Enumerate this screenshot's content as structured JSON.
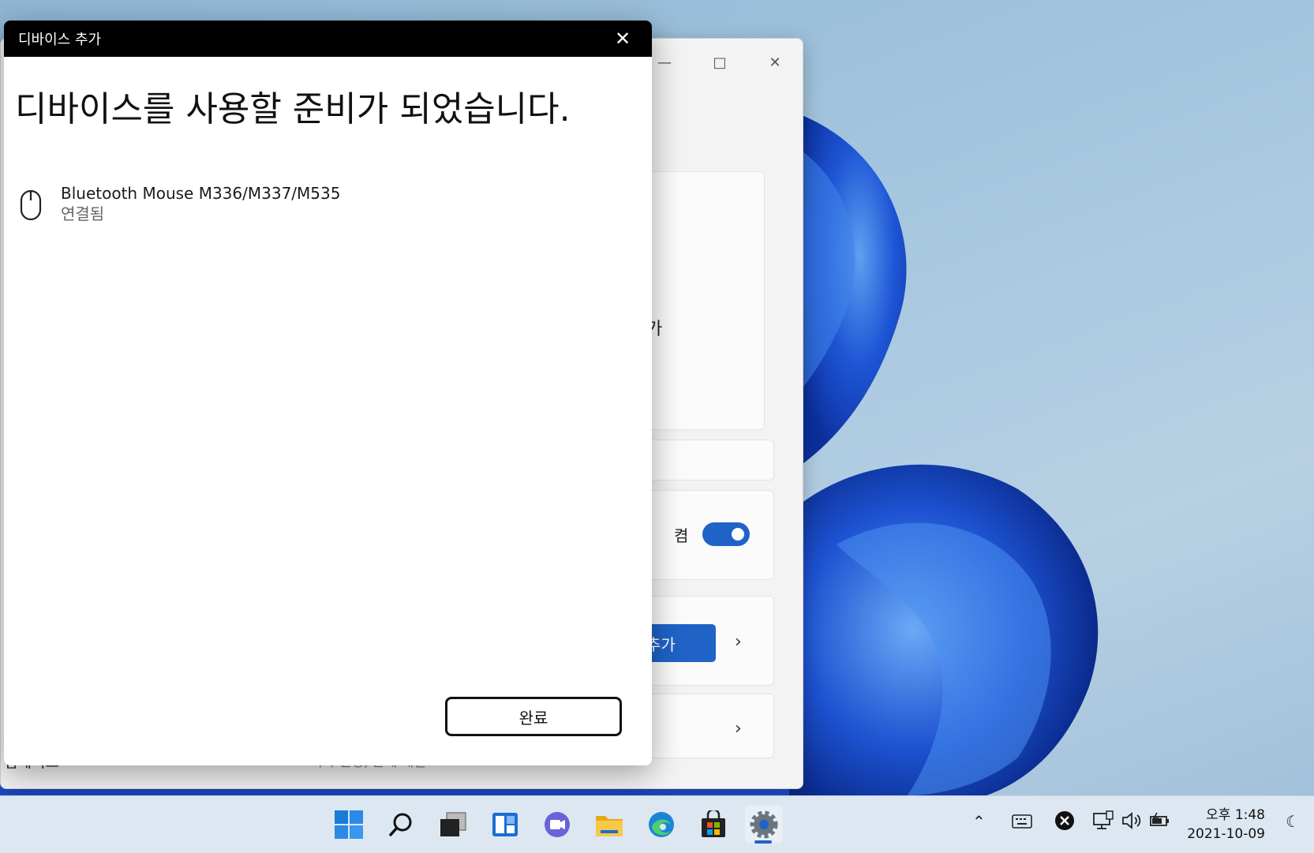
{
  "dialog": {
    "title": "디바이스 추가",
    "heading": "디바이스를 사용할 준비가 되었습니다.",
    "device": {
      "name": "Bluetooth Mouse M336/M337/M535",
      "status": "연결됨",
      "icon": "mouse-icon"
    },
    "done_label": "완료"
  },
  "settings_window": {
    "partial_text_1": ".",
    "partial_text_2": "가",
    "toggle_label": "켬",
    "toggle_state": "on",
    "add_button_label": "추가",
    "bottom_left_text": "업데이트",
    "bottom_mid_text": "기타 설정, 문제 해결"
  },
  "taskbar": {
    "icons": [
      "windows-start-icon",
      "search-icon",
      "task-view-icon",
      "widgets-icon",
      "chat-icon",
      "file-explorer-icon",
      "edge-icon",
      "store-icon",
      "settings-icon"
    ],
    "time": "오후 1:48",
    "date": "2021-10-09"
  },
  "colors": {
    "accent": "#1f63c7",
    "titlebar": "#000000"
  }
}
